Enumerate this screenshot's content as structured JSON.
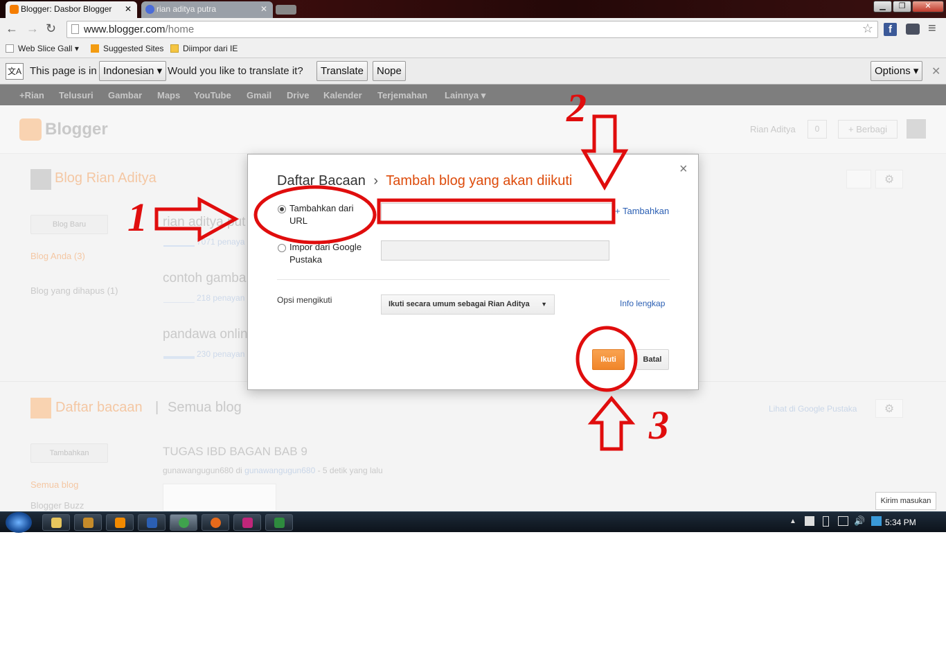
{
  "browser": {
    "tabs": [
      {
        "title": "Blogger: Dasbor Blogger"
      },
      {
        "title": "rian aditya putra"
      }
    ],
    "address": {
      "host": "www.blogger.com",
      "path": "/home"
    },
    "bookmarks": [
      "Web Slice Gall",
      "Suggested Sites",
      "Diimpor dari IE"
    ],
    "translate": {
      "prefix": "This page is in",
      "language": "Indonesian",
      "question": "Would you like to translate it?",
      "translate_label": "Translate",
      "nope_label": "Nope",
      "options_label": "Options"
    }
  },
  "google_bar": [
    "+Rian",
    "Telusuri",
    "Gambar",
    "Maps",
    "YouTube",
    "Gmail",
    "Drive",
    "Kalender",
    "Terjemahan",
    "Lainnya"
  ],
  "blogger": {
    "logo": "Blogger",
    "user": "Rian Aditya",
    "notif_count": "0",
    "share_label": "+ Berbagi",
    "blog_title": "Blog Rian Aditya",
    "new_blog_btn": "Blog Baru",
    "blog_anda": "Blog Anda (3)",
    "deleted_blogs": "Blog yang dihapus (1)",
    "posts": [
      {
        "title": "rian aditya put",
        "views": "7071 penaya"
      },
      {
        "title": "contoh gamba",
        "views": "218 penayan"
      },
      {
        "title": "pandawa onlin",
        "views": "230 penayan"
      }
    ],
    "reading_list": "Daftar bacaan",
    "all_blogs": "Semua blog",
    "view_in_reader": "Lihat di Google Pustaka",
    "add_btn": "Tambahkan",
    "all_blogs_link": "Semua blog",
    "blogger_buzz": "Blogger Buzz",
    "feed_title": "TUGAS IBD BAGAN BAB 9",
    "feed_author": "gunawangugun680",
    "feed_in": "di",
    "feed_blog": "gunawangugun680",
    "feed_time": "- 5 detik yang lalu",
    "feedback": "Kirim masukan"
  },
  "dialog": {
    "breadcrumb_root": "Daftar Bacaan",
    "separator": "›",
    "title": "Tambah blog yang akan diikuti",
    "option_url_line1": "Tambahkan dari",
    "option_url_line2": "URL",
    "add_link": "+ Tambahkan",
    "option_import_line1": "Impor dari Google",
    "option_import_line2": "Pustaka",
    "follow_options_label": "Opsi mengikuti",
    "follow_select": "Ikuti secara umum sebagai Rian Aditya",
    "info_link": "Info lengkap",
    "follow_btn": "Ikuti",
    "cancel_btn": "Batal",
    "close": "×"
  },
  "annotations": {
    "n1": "1",
    "n2": "2",
    "n3": "3"
  },
  "taskbar": {
    "clock": "5:34 PM"
  },
  "colors": {
    "blogger_orange": "#f57d00",
    "annotation_red": "#e00d0d",
    "follow_orange": "#f69a3a"
  }
}
